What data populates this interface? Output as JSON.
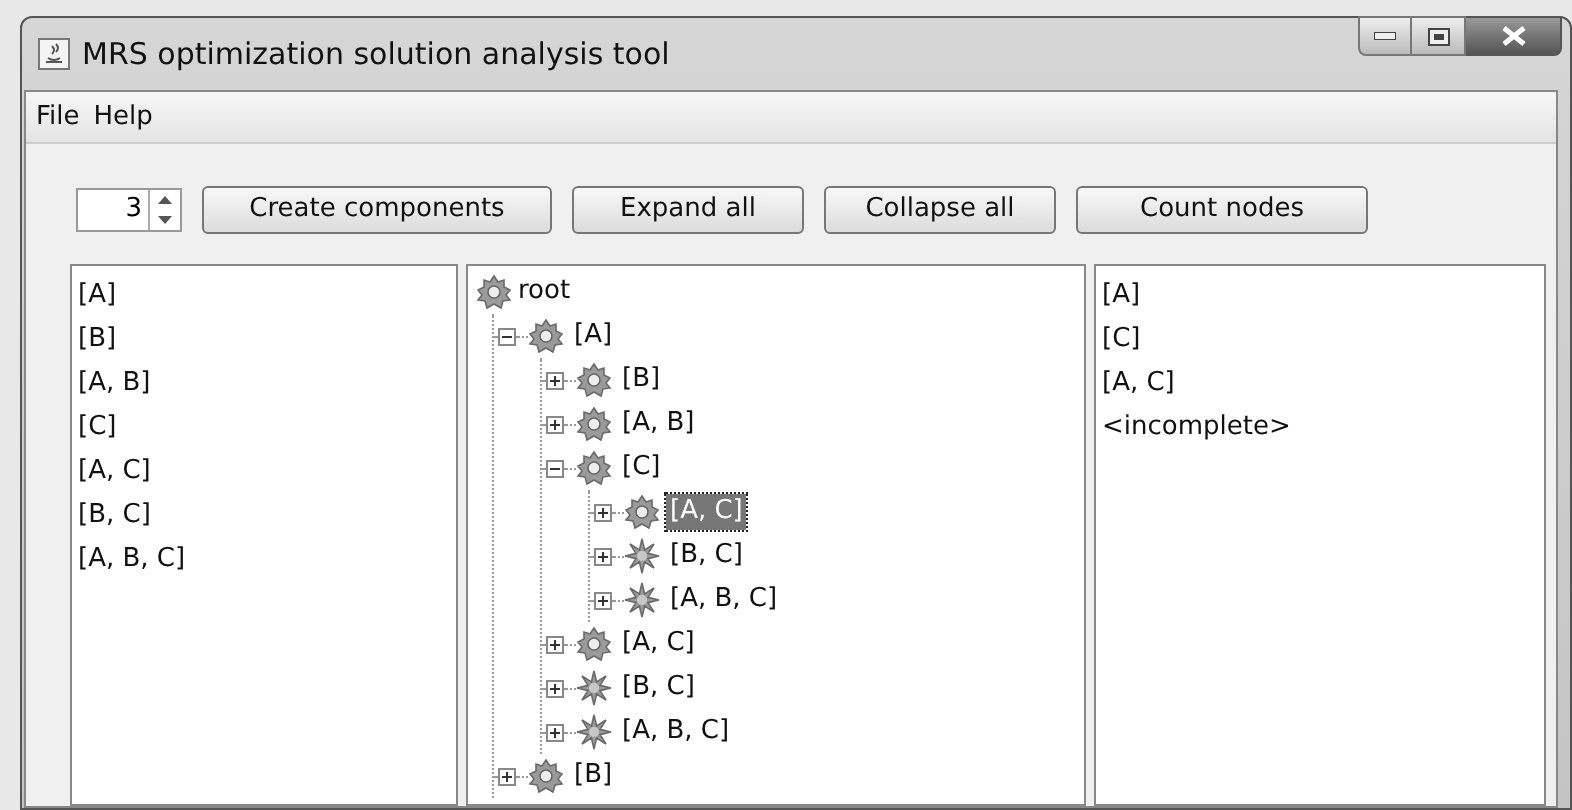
{
  "window": {
    "title": "MRS optimization solution analysis tool"
  },
  "menu": [
    "File",
    "Help"
  ],
  "toolbar": {
    "spinner": {
      "value": "3"
    },
    "buttons": [
      "Create components",
      "Expand all",
      "Collapse all",
      "Count nodes"
    ]
  },
  "components": [
    "[A]",
    "[B]",
    "[A, B]",
    "[C]",
    "[A, C]",
    "[B, C]",
    "[A, B, C]"
  ],
  "tree": {
    "root": {
      "label": "root",
      "kind": "gear"
    },
    "children": [
      {
        "label": "[A]",
        "kind": "gear",
        "expanded": true,
        "selected": false,
        "children": [
          {
            "label": "[B]",
            "kind": "gear",
            "expanded": false,
            "selected": false
          },
          {
            "label": "[A, B]",
            "kind": "gear",
            "expanded": false,
            "selected": false
          },
          {
            "label": "[C]",
            "kind": "gear",
            "expanded": true,
            "selected": false,
            "children": [
              {
                "label": "[A, C]",
                "kind": "gear",
                "expanded": false,
                "selected": true
              },
              {
                "label": "[B, C]",
                "kind": "star",
                "expanded": false,
                "selected": false
              },
              {
                "label": "[A, B, C]",
                "kind": "star",
                "expanded": false,
                "selected": false
              }
            ]
          },
          {
            "label": "[A, C]",
            "kind": "gear",
            "expanded": false,
            "selected": false
          },
          {
            "label": "[B, C]",
            "kind": "star",
            "expanded": false,
            "selected": false
          },
          {
            "label": "[A, B, C]",
            "kind": "star",
            "expanded": false,
            "selected": false
          }
        ]
      },
      {
        "label": "[B]",
        "kind": "gear",
        "expanded": false,
        "selected": false
      }
    ]
  },
  "details": [
    "[A]",
    "[C]",
    "[A, C]",
    "<incomplete>"
  ]
}
